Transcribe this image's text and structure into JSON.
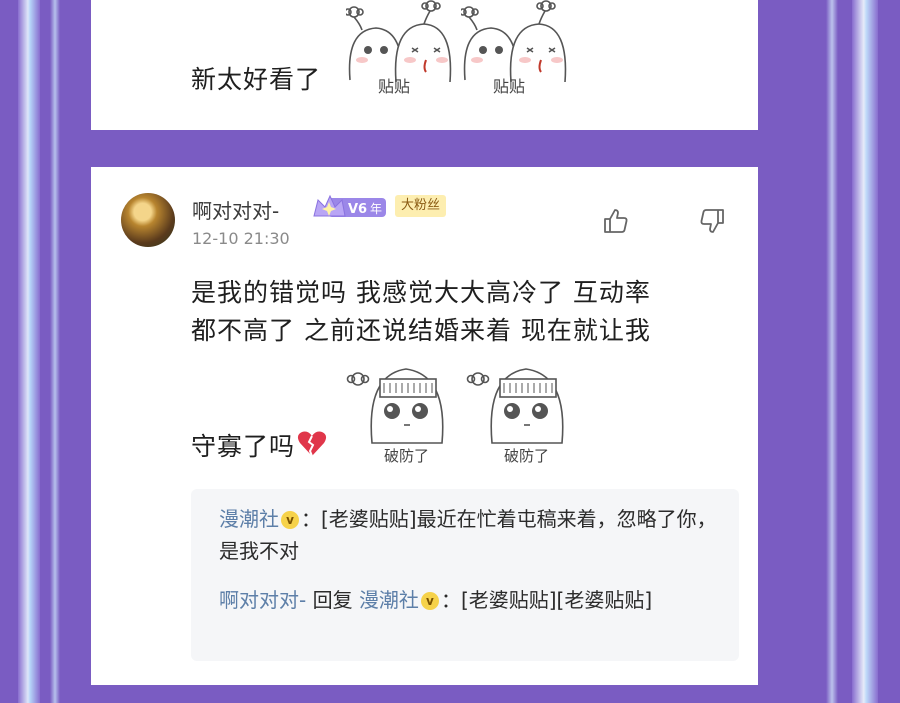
{
  "top_comment": {
    "text": "新太好看了",
    "sticker_caption_1": "贴贴",
    "sticker_caption_2": "贴贴"
  },
  "comment": {
    "username": "啊对对对-",
    "vip_level": "V6",
    "vip_suffix": "年",
    "fan_badge": "大粉丝",
    "timestamp": "12-10 21:30",
    "line1": "是我的错觉吗 我感觉大大高冷了 互动率",
    "line2": "都不高了 之前还说结婚来着 现在就让我",
    "line3": "守寡了吗",
    "sticker_caption_1": "破防了",
    "sticker_caption_2": "破防了"
  },
  "replies": [
    {
      "author": "漫潮社",
      "verified_mark": "v",
      "separator": "：",
      "text": "[老婆贴贴]最近在忙着屯稿来着，忽略了你，是我不对"
    },
    {
      "author": "啊对对对-",
      "reply_word": " 回复 ",
      "target": "漫潮社",
      "verified_mark": "v",
      "separator": "：",
      "text": "[老婆贴贴][老婆贴贴]"
    }
  ],
  "colors": {
    "background": "#7a5cc2",
    "link_name": "#5d7fa8",
    "fan_badge_bg": "#fdeeb0"
  },
  "icons": [
    "like-icon",
    "dislike-icon",
    "broken-heart-icon",
    "vip-crown-icon"
  ]
}
